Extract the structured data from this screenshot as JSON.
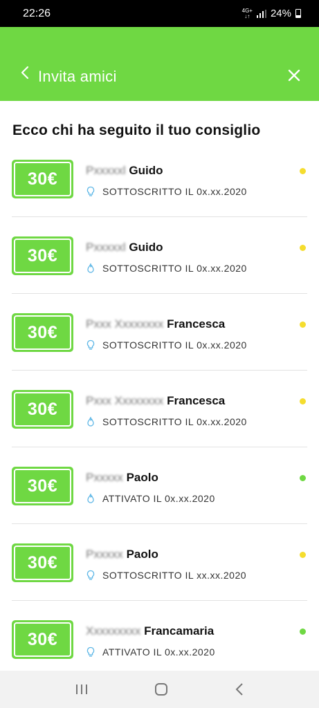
{
  "status_bar": {
    "time": "22:26",
    "network": "4G+",
    "battery": "24%"
  },
  "header": {
    "title": "Invita amici",
    "back_icon": "chevron-left-icon",
    "close_icon": "close-icon",
    "background": "#6fd843"
  },
  "heading": "Ecco chi ha seguito il tuo consiglio",
  "colors": {
    "accent": "#6fd843",
    "pending_dot": "#f5dd2e",
    "active_dot": "#6fd843",
    "icon_blue": "#5cb6e6"
  },
  "referrals": [
    {
      "amount": "30€",
      "surname": "Pxxxxxl",
      "firstname": "Guido",
      "status": "SOTTOSCRITTO IL 0x.xx.2020",
      "icon": "lightbulb-icon",
      "dot": "pending"
    },
    {
      "amount": "30€",
      "surname": "Pxxxxxl",
      "firstname": "Guido",
      "status": "SOTTOSCRITTO IL 0x.xx.2020",
      "icon": "flame-icon",
      "dot": "pending"
    },
    {
      "amount": "30€",
      "surname": "Pxxx Xxxxxxxx",
      "firstname": "Francesca",
      "status": "SOTTOSCRITTO IL 0x.xx.2020",
      "icon": "lightbulb-icon",
      "dot": "pending"
    },
    {
      "amount": "30€",
      "surname": "Pxxx Xxxxxxxx",
      "firstname": "Francesca",
      "status": "SOTTOSCRITTO IL 0x.xx.2020",
      "icon": "flame-icon",
      "dot": "pending"
    },
    {
      "amount": "30€",
      "surname": "Pxxxxx",
      "firstname": "Paolo",
      "status": "ATTIVATO IL 0x.xx.2020",
      "icon": "flame-icon",
      "dot": "active"
    },
    {
      "amount": "30€",
      "surname": "Pxxxxx",
      "firstname": "Paolo",
      "status": "SOTTOSCRITTO IL xx.xx.2020",
      "icon": "lightbulb-icon",
      "dot": "pending"
    },
    {
      "amount": "30€",
      "surname": "Xxxxxxxxx",
      "firstname": "Francamaria",
      "status": "ATTIVATO IL 0x.xx.2020",
      "icon": "lightbulb-icon",
      "dot": "active"
    }
  ],
  "nav_bar": {
    "recents_icon": "recents-icon",
    "home_icon": "home-icon",
    "back_icon": "back-icon"
  }
}
